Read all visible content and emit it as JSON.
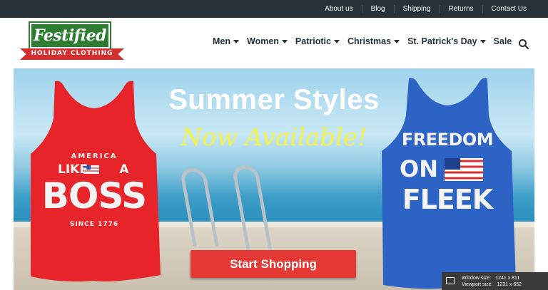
{
  "topbar": {
    "links": [
      "About us",
      "Blog",
      "Shipping",
      "Returns",
      "Contact Us"
    ]
  },
  "logo": {
    "word": "Festified",
    "tagline": "HOLIDAY CLOTHING"
  },
  "nav": {
    "items": [
      {
        "label": "Men"
      },
      {
        "label": "Women"
      },
      {
        "label": "Patriotic"
      },
      {
        "label": "Christmas"
      },
      {
        "label": "St. Patrick's Day"
      },
      {
        "label": "Sale"
      }
    ],
    "search_icon": "search-icon"
  },
  "hero": {
    "title": "Summer Styles",
    "subtitle": "Now Available!",
    "cta": "Start Shopping",
    "left_tank": {
      "line1": "AMERICA",
      "line2": "LIKE",
      "line3": "A",
      "line4": "BOSS",
      "line5": "SINCE 1776",
      "color": "#e8242b"
    },
    "right_tank": {
      "line1": "FREEDOM",
      "line2": "ON",
      "line3": "FLEEK",
      "color": "#2e63c6"
    }
  },
  "devtools": {
    "window_label": "Window size:",
    "window_value": "1241 x 811",
    "viewport_label": "Viewport size:",
    "viewport_value": "1231 x 652"
  },
  "colors": {
    "topbar_bg": "#263238",
    "cta_bg": "#e53935",
    "logo_green": "#2e7d32",
    "logo_red": "#d32f2f",
    "subtitle": "#f4f14a"
  }
}
